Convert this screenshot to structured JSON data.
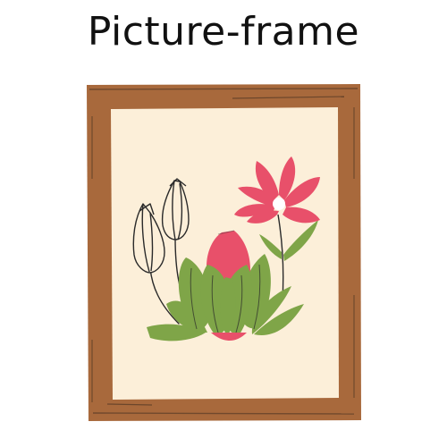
{
  "title": "Picture-frame",
  "colors": {
    "frame": "#A8693C",
    "canvas": "#FCEFD9",
    "petal": "#E8506A",
    "leaf": "#7FA548",
    "outline": "#2A2A2A"
  },
  "icons": [
    "picture-frame-icon",
    "flower-icon",
    "bud-icon"
  ]
}
